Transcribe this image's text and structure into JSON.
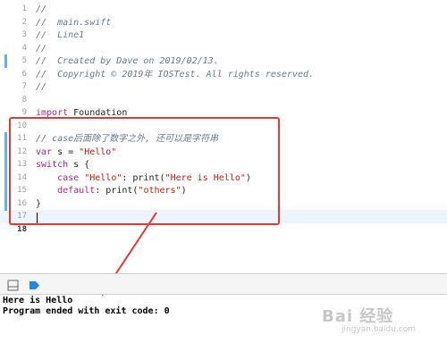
{
  "editor": {
    "lines": [
      {
        "n": "1",
        "t": "//",
        "c": "comment"
      },
      {
        "n": "2",
        "t": "//  main.swift",
        "c": "comment"
      },
      {
        "n": "3",
        "t": "//  Line1",
        "c": "comment"
      },
      {
        "n": "4",
        "t": "//",
        "c": "comment"
      },
      {
        "n": "5",
        "t": "//  Created by Dave on 2019/02/13.",
        "c": "comment"
      },
      {
        "n": "6",
        "t": "//  Copyright © 2019年 IOSTest. All rights reserved.",
        "c": "comment"
      },
      {
        "n": "7",
        "t": "//",
        "c": "comment"
      },
      {
        "n": "8",
        "t": "",
        "c": ""
      },
      {
        "n": "9",
        "t": "import Foundation",
        "c": ""
      },
      {
        "n": "10",
        "t": "",
        "c": ""
      },
      {
        "n": "11",
        "t": "// case后面除了数字之外, 还可以是字符串",
        "c": "comment"
      },
      {
        "n": "12",
        "t": "var s = \"Hello\"",
        "c": ""
      },
      {
        "n": "13",
        "t": "switch s {",
        "c": ""
      },
      {
        "n": "14",
        "t": "    case \"Hello\": print(\"Here is Hello\")",
        "c": ""
      },
      {
        "n": "15",
        "t": "    default: print(\"others\")",
        "c": ""
      },
      {
        "n": "16",
        "t": "}",
        "c": ""
      },
      {
        "n": "17",
        "t": "",
        "c": ""
      },
      {
        "n": "18",
        "t": "",
        "c": ""
      }
    ],
    "current_line": "18"
  },
  "console": {
    "output": "Here is Hello\nProgram ended with exit code: 0"
  },
  "watermark": {
    "main": "Bai 经验",
    "sub": "jingyan.baidu.com"
  },
  "colors": {
    "annotation": "#e53935",
    "highlight": "#5fb3f3"
  }
}
